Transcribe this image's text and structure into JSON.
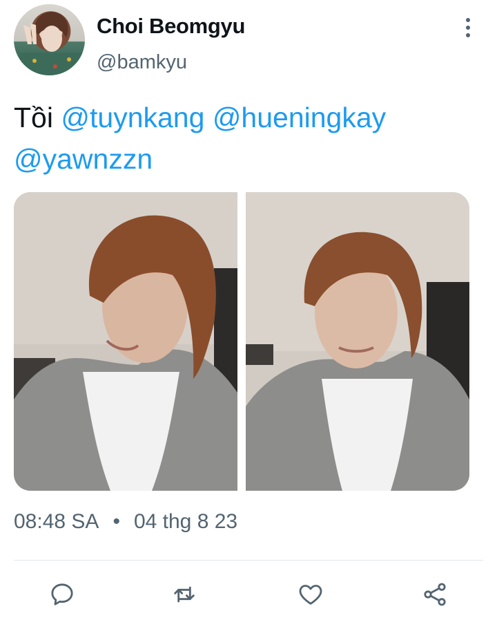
{
  "author": {
    "display_name": "Choi Beomgyu",
    "handle": "@bamkyu",
    "avatar_icon": "profile-photo"
  },
  "tweet": {
    "text_prefix": "Tồi",
    "mentions": [
      "@tuynkang",
      "@hueningkay",
      "@yawnzzn"
    ],
    "media_count": 2
  },
  "meta": {
    "time": "08:48 SA",
    "separator": "•",
    "date": "04 thg 8 23"
  },
  "actions": [
    {
      "name": "reply",
      "icon": "comment-icon"
    },
    {
      "name": "retweet",
      "icon": "retweet-icon"
    },
    {
      "name": "like",
      "icon": "heart-icon"
    },
    {
      "name": "share",
      "icon": "share-icon"
    }
  ],
  "colors": {
    "text_primary": "#0f1419",
    "text_secondary": "#536471",
    "accent": "#1d9bf0",
    "divider": "#e1e8ed"
  }
}
